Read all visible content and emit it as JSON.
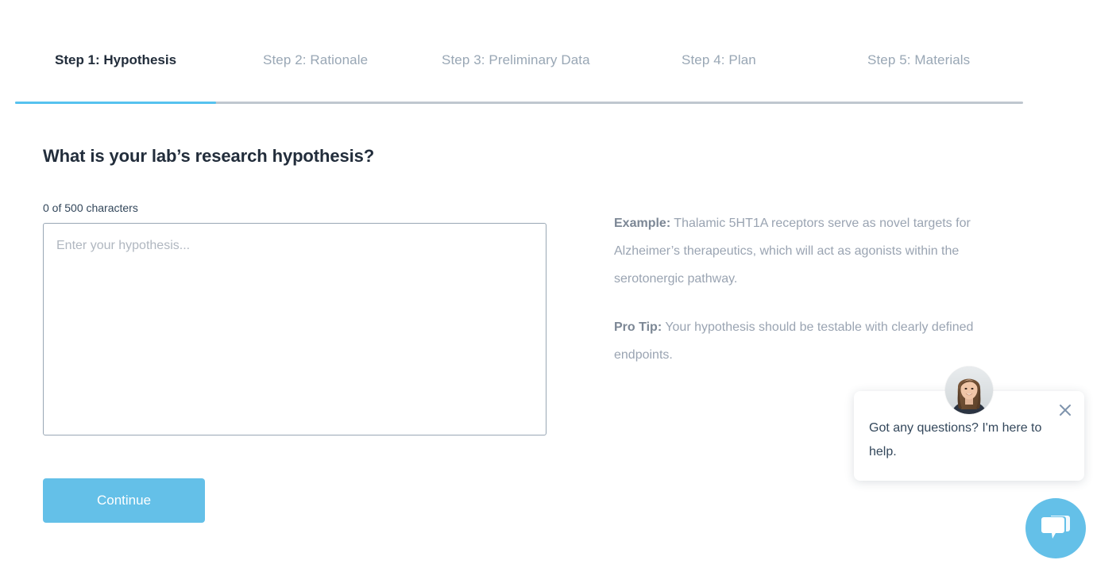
{
  "stepper": {
    "accent_color": "#56c2ef",
    "track_color": "#bfc7cf",
    "active_index": 0,
    "steps": [
      {
        "label": "Step 1: Hypothesis"
      },
      {
        "label": "Step 2: Rationale"
      },
      {
        "label": "Step 3: Preliminary Data"
      },
      {
        "label": "Step 4: Plan"
      },
      {
        "label": "Step 5: Materials"
      }
    ]
  },
  "form": {
    "question": "What is your lab’s research hypothesis?",
    "char_counter": "0 of 500 characters",
    "hypothesis_value": "",
    "hypothesis_placeholder": "Enter your hypothesis...",
    "continue_label": "Continue",
    "continue_color": "#64c0e8"
  },
  "guidance": {
    "example_lead": "Example:",
    "example_text": " Thalamic 5HT1A receptors serve as novel targets for Alzheimer’s therapeutics, which will act as agonists within the serotonergic pathway.",
    "protip_lead": "Pro Tip:",
    "protip_text": " Your hypothesis should be testable with clearly defined endpoints."
  },
  "chat": {
    "avatar_name": "agent-avatar",
    "message": "Got any questions? I'm here to help.",
    "close_icon": "close-icon",
    "launcher_icon": "chat-bubbles-icon",
    "launcher_color": "#64c0e8"
  }
}
